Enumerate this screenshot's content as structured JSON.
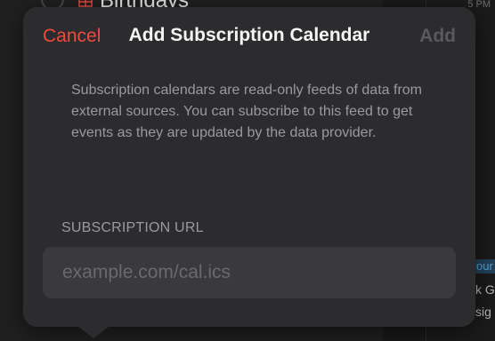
{
  "background": {
    "row_label": "Birthdays",
    "time_label": "5 PM",
    "event_chip": "our",
    "event_text_1": "k G",
    "event_text_2": "sig"
  },
  "nav": {
    "cancel_label": "Cancel",
    "title": "Add Subscription Calendar",
    "add_label": "Add"
  },
  "description": "Subscription calendars are read-only feeds of data from external sources. You can subscribe to this feed to get events as they are updated by the data provider.",
  "url_field": {
    "label": "SUBSCRIPTION URL",
    "placeholder": "example.com/cal.ics",
    "value": ""
  },
  "colors": {
    "accent": "#ef4a3d",
    "sheet_background": "#2c2c2e",
    "field_background": "#3a3a3c",
    "disabled_text": "#5a5a5c"
  }
}
